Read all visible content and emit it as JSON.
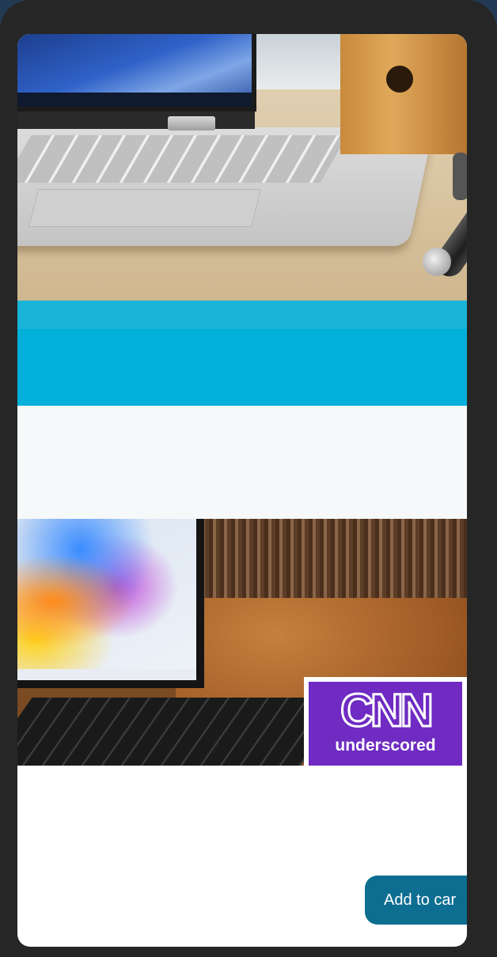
{
  "promo": {
    "badge_brand": "CNN",
    "badge_sub": "underscored"
  },
  "actions": {
    "add_to_cart_label": "Add to car"
  },
  "colors": {
    "band_light": "#1ab4d8",
    "band_dark": "#03b0da",
    "badge_purple": "#6f2bc2",
    "cart_button": "#0d6e91"
  }
}
